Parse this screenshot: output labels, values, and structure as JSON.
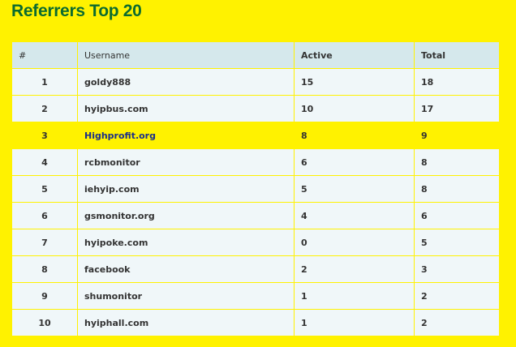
{
  "page": {
    "title": "Referrers Top 20"
  },
  "table": {
    "headers": {
      "num": "#",
      "username": "Username",
      "active": "Active",
      "total": "Total"
    },
    "rows": [
      {
        "num": "1",
        "username": "goldy888",
        "active": "15",
        "total": "18"
      },
      {
        "num": "2",
        "username": "hyipbus.com",
        "active": "10",
        "total": "17"
      },
      {
        "num": "3",
        "username": "Highprofit.org",
        "active": "8",
        "total": "9"
      },
      {
        "num": "4",
        "username": "rcbmonitor",
        "active": "6",
        "total": "8"
      },
      {
        "num": "5",
        "username": "iehyip.com",
        "active": "5",
        "total": "8"
      },
      {
        "num": "6",
        "username": "gsmonitor.org",
        "active": "4",
        "total": "6"
      },
      {
        "num": "7",
        "username": "hyipoke.com",
        "active": "0",
        "total": "5"
      },
      {
        "num": "8",
        "username": "facebook",
        "active": "2",
        "total": "3"
      },
      {
        "num": "9",
        "username": "shumonitor",
        "active": "1",
        "total": "2"
      },
      {
        "num": "10",
        "username": "hyiphall.com",
        "active": "1",
        "total": "2"
      }
    ]
  },
  "colors": {
    "background": "#fff200",
    "title": "#0c6b2f",
    "header_bg": "#d5e8ec",
    "row_bg": "#f0f7f9",
    "highlight_text": "#1b2f8a"
  }
}
